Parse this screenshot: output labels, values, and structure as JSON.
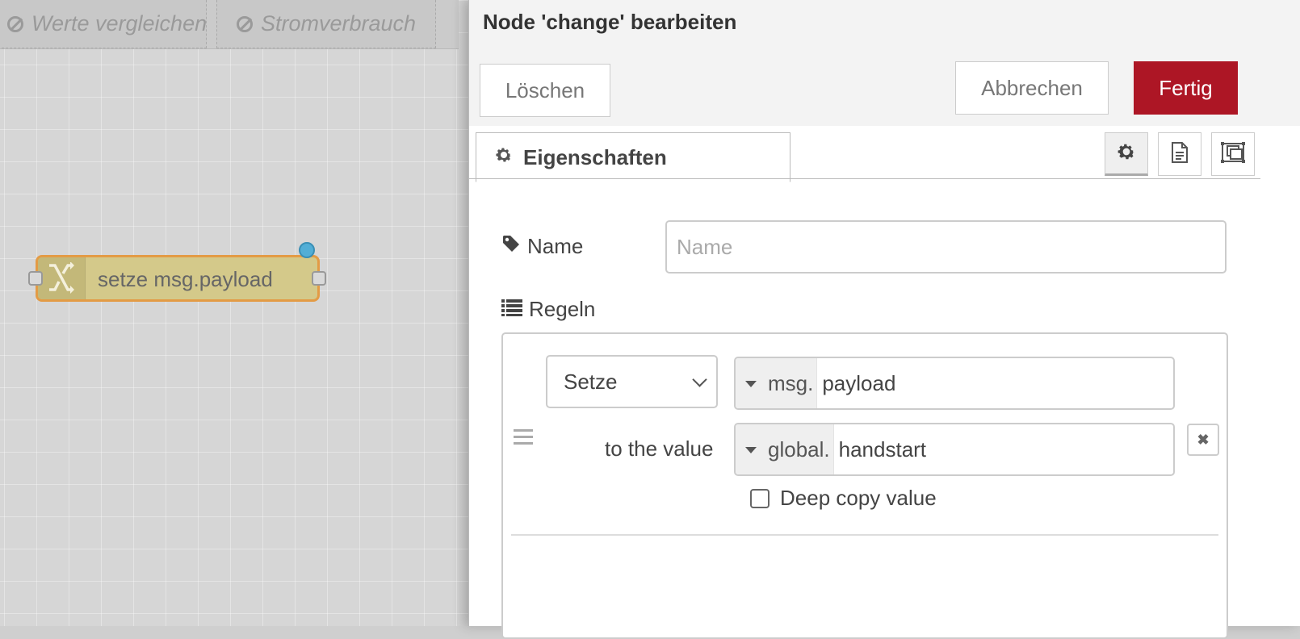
{
  "workspace": {
    "tabs": [
      {
        "label": "Werte vergleichen"
      },
      {
        "label": "Stromverbrauch"
      }
    ],
    "node": {
      "label": "setze msg.payload",
      "icon": "shuffle-icon"
    }
  },
  "editor": {
    "title": "Node 'change' bearbeiten",
    "buttons": {
      "delete": "Löschen",
      "cancel": "Abbrechen",
      "done": "Fertig"
    },
    "colors": {
      "primary": "#ad1625",
      "node_fill": "#d4c98a",
      "node_selected_border": "#e39b45",
      "status_dot": "#52aed6"
    },
    "tabs": {
      "properties": "Eigenschaften",
      "icons": [
        "gear-icon",
        "description-icon",
        "appearance-icon"
      ]
    },
    "name": {
      "label": "Name",
      "placeholder": "Name",
      "value": ""
    },
    "rules": {
      "label": "Regeln",
      "items": [
        {
          "action": "Setze",
          "target_type": "msg.",
          "target_value": "payload",
          "to_label": "to the value",
          "source_type": "global.",
          "source_value": "handstart",
          "deep_copy_label": "Deep copy value",
          "deep_copy_checked": false
        }
      ]
    }
  }
}
